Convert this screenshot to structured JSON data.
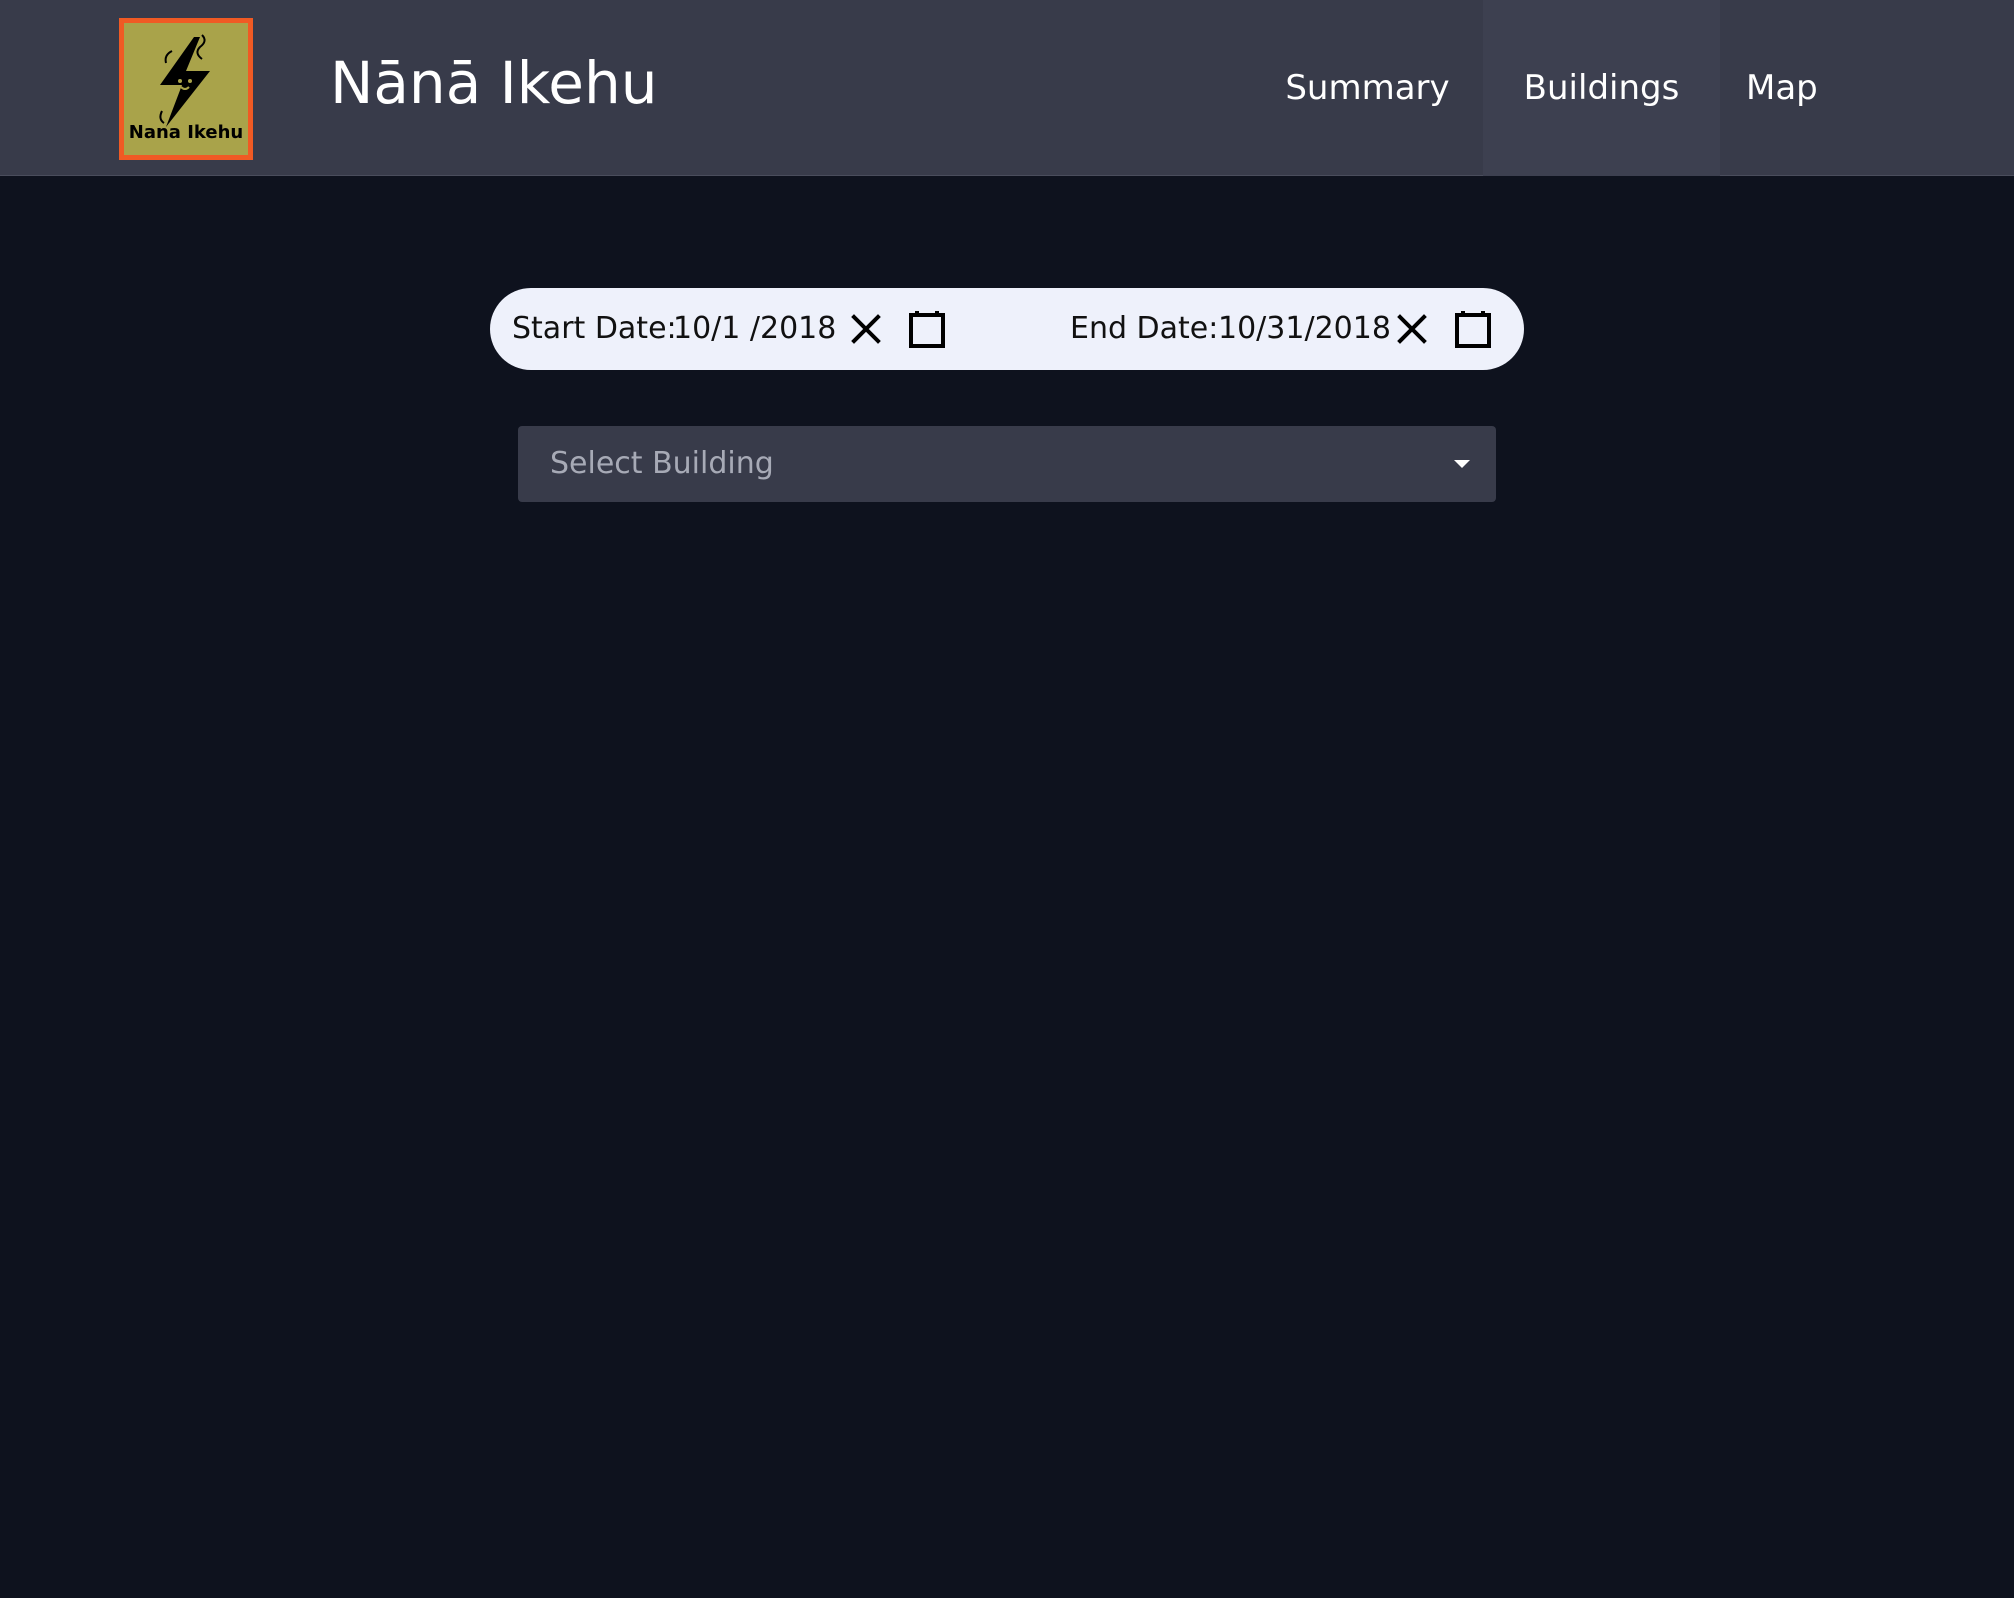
{
  "header": {
    "logo_text": "Nana Ikehu",
    "title": "Nānā Ikehu"
  },
  "nav": {
    "summary": "Summary",
    "buildings": "Buildings",
    "map": "Map",
    "active": "Buildings"
  },
  "date_range": {
    "start_label": "Start Date:",
    "start_value": "10/1 /2018",
    "end_label": "End Date:",
    "end_value": "10/31/2018"
  },
  "building_select": {
    "placeholder": "Select Building",
    "selected": ""
  },
  "icons": {
    "clear": "close-icon",
    "calendar": "calendar-icon",
    "dropdown": "caret-down-icon",
    "logo": "lightning-bolt-icon"
  },
  "colors": {
    "page_bg": "#0e121e",
    "navbar_bg": "#383b4a",
    "logo_border": "#f05a24",
    "logo_fill": "#a9a34a",
    "date_bar_bg": "#eef1fb"
  }
}
